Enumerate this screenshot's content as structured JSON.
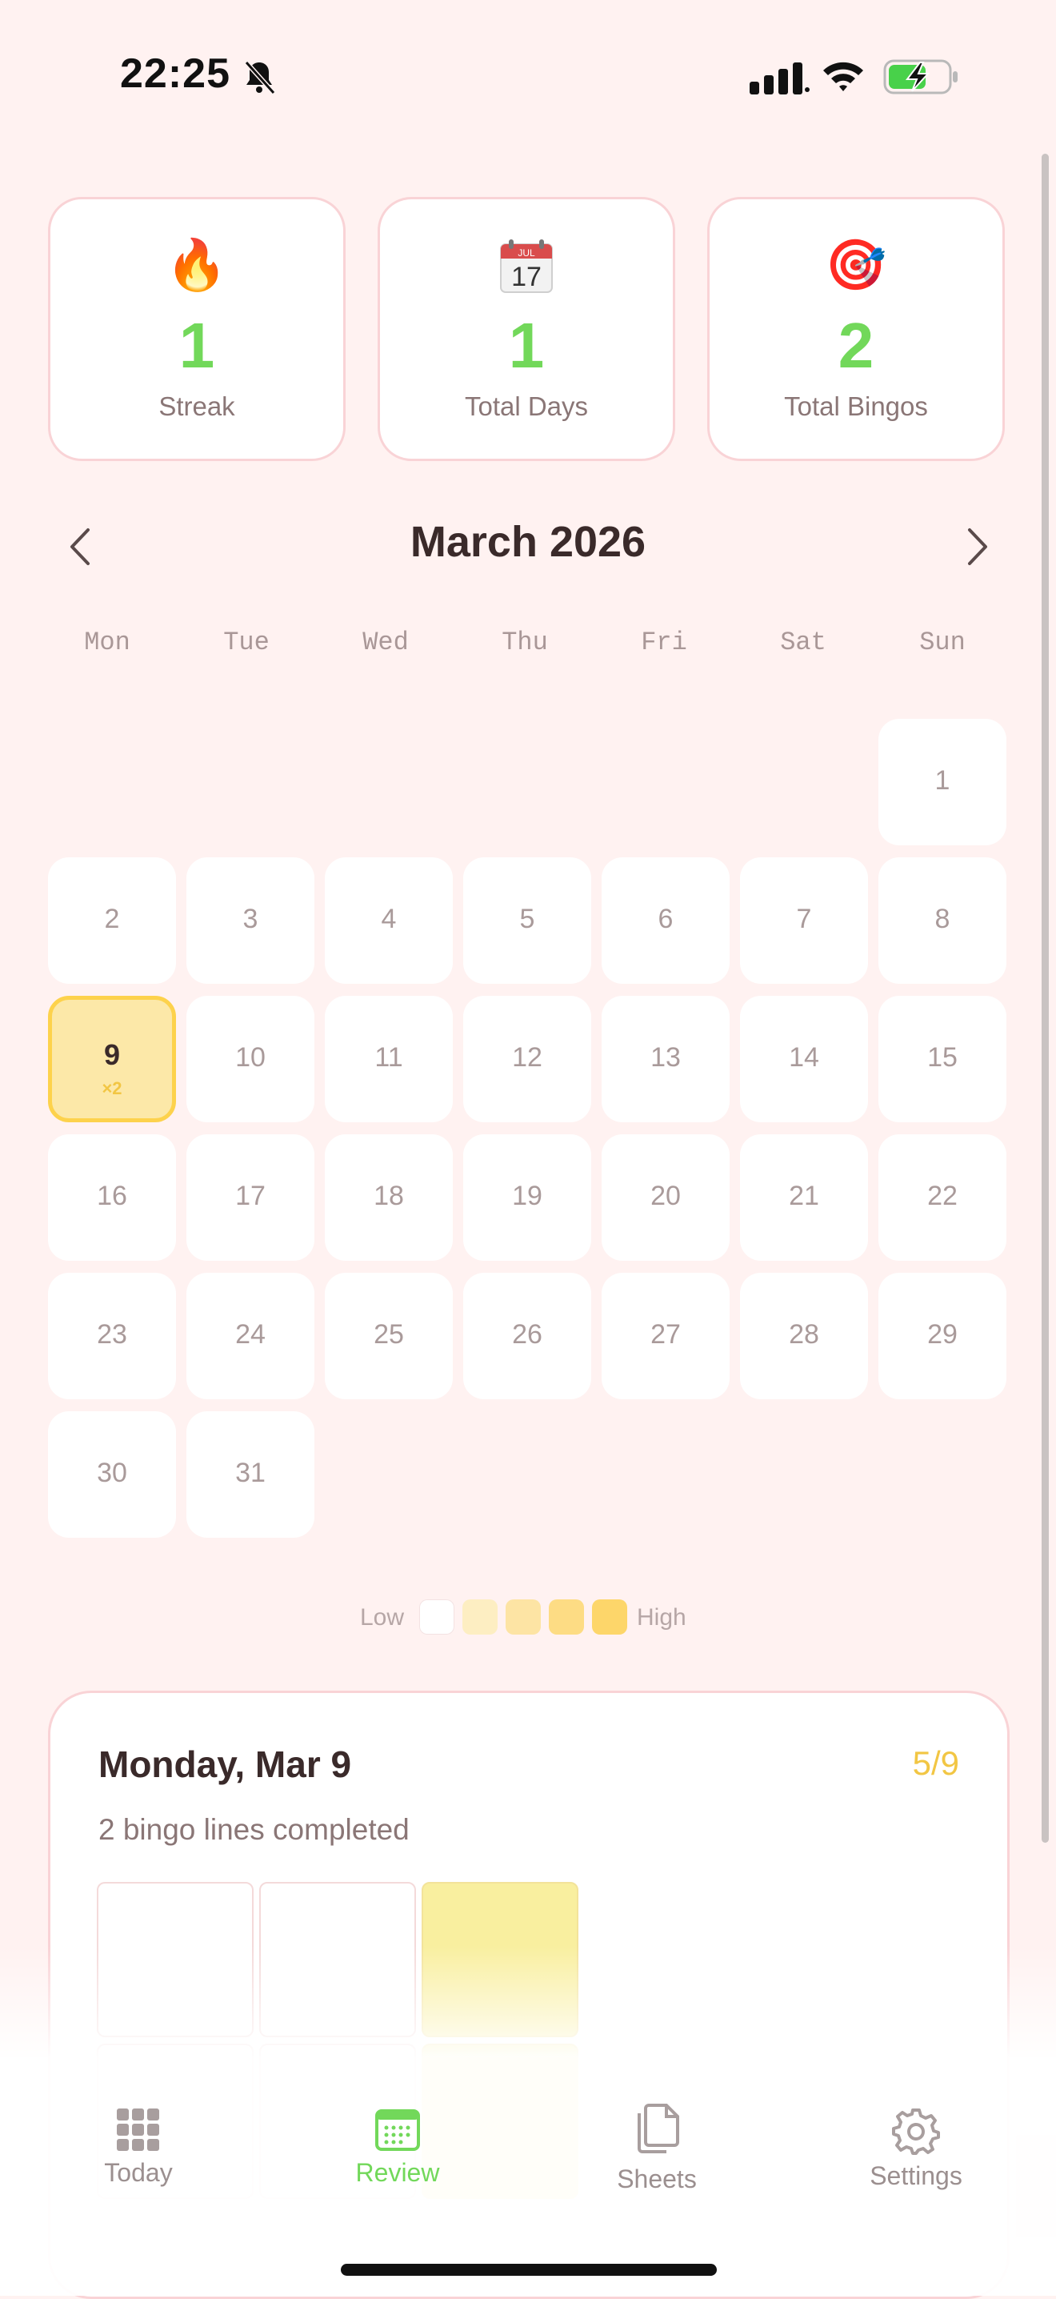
{
  "status_bar": {
    "time": "22:25",
    "icons": [
      "bell-slash-icon",
      "cellular-signal-icon",
      "wifi-icon",
      "battery-charging-icon"
    ]
  },
  "stats": [
    {
      "icon": "fire-icon",
      "emoji": "🔥",
      "value": "1",
      "label": "Streak"
    },
    {
      "icon": "calendar-icon",
      "value": "1",
      "label": "Total Days",
      "calendar_month": "JUL",
      "calendar_day": "17"
    },
    {
      "icon": "target-icon",
      "emoji": "🎯",
      "value": "2",
      "label": "Total Bingos"
    }
  ],
  "calendar": {
    "month_title": "March 2026",
    "prev_icon": "chevron-left-icon",
    "next_icon": "chevron-right-icon",
    "weekdays": [
      "Mon",
      "Tue",
      "Wed",
      "Thu",
      "Fri",
      "Sat",
      "Sun"
    ],
    "first_weekday_index": 6,
    "days_in_month": 31,
    "selected_day": 9,
    "selected_day_count": "×2"
  },
  "legend": {
    "low": "Low",
    "high": "High",
    "colors": [
      "#ffffff",
      "#fdeec2",
      "#fde4a4",
      "#fddc84",
      "#fdd66a"
    ]
  },
  "detail": {
    "title": "Monday, Mar 9",
    "score": "5/9",
    "subtitle": "2 bingo lines completed",
    "grid_visible_row1": [
      false,
      false,
      true
    ]
  },
  "tabs": [
    {
      "label": "Today",
      "icon": "grid-icon",
      "active": false
    },
    {
      "label": "Review",
      "icon": "calendar-grid-icon",
      "active": true
    },
    {
      "label": "Sheets",
      "icon": "documents-icon",
      "active": false
    },
    {
      "label": "Settings",
      "icon": "gear-icon",
      "active": false
    }
  ],
  "colors": {
    "accent_green": "#72d85a",
    "highlight_yellow": "#fdd24c",
    "card_border": "#f9d3d6",
    "background": "#fff2f1"
  }
}
